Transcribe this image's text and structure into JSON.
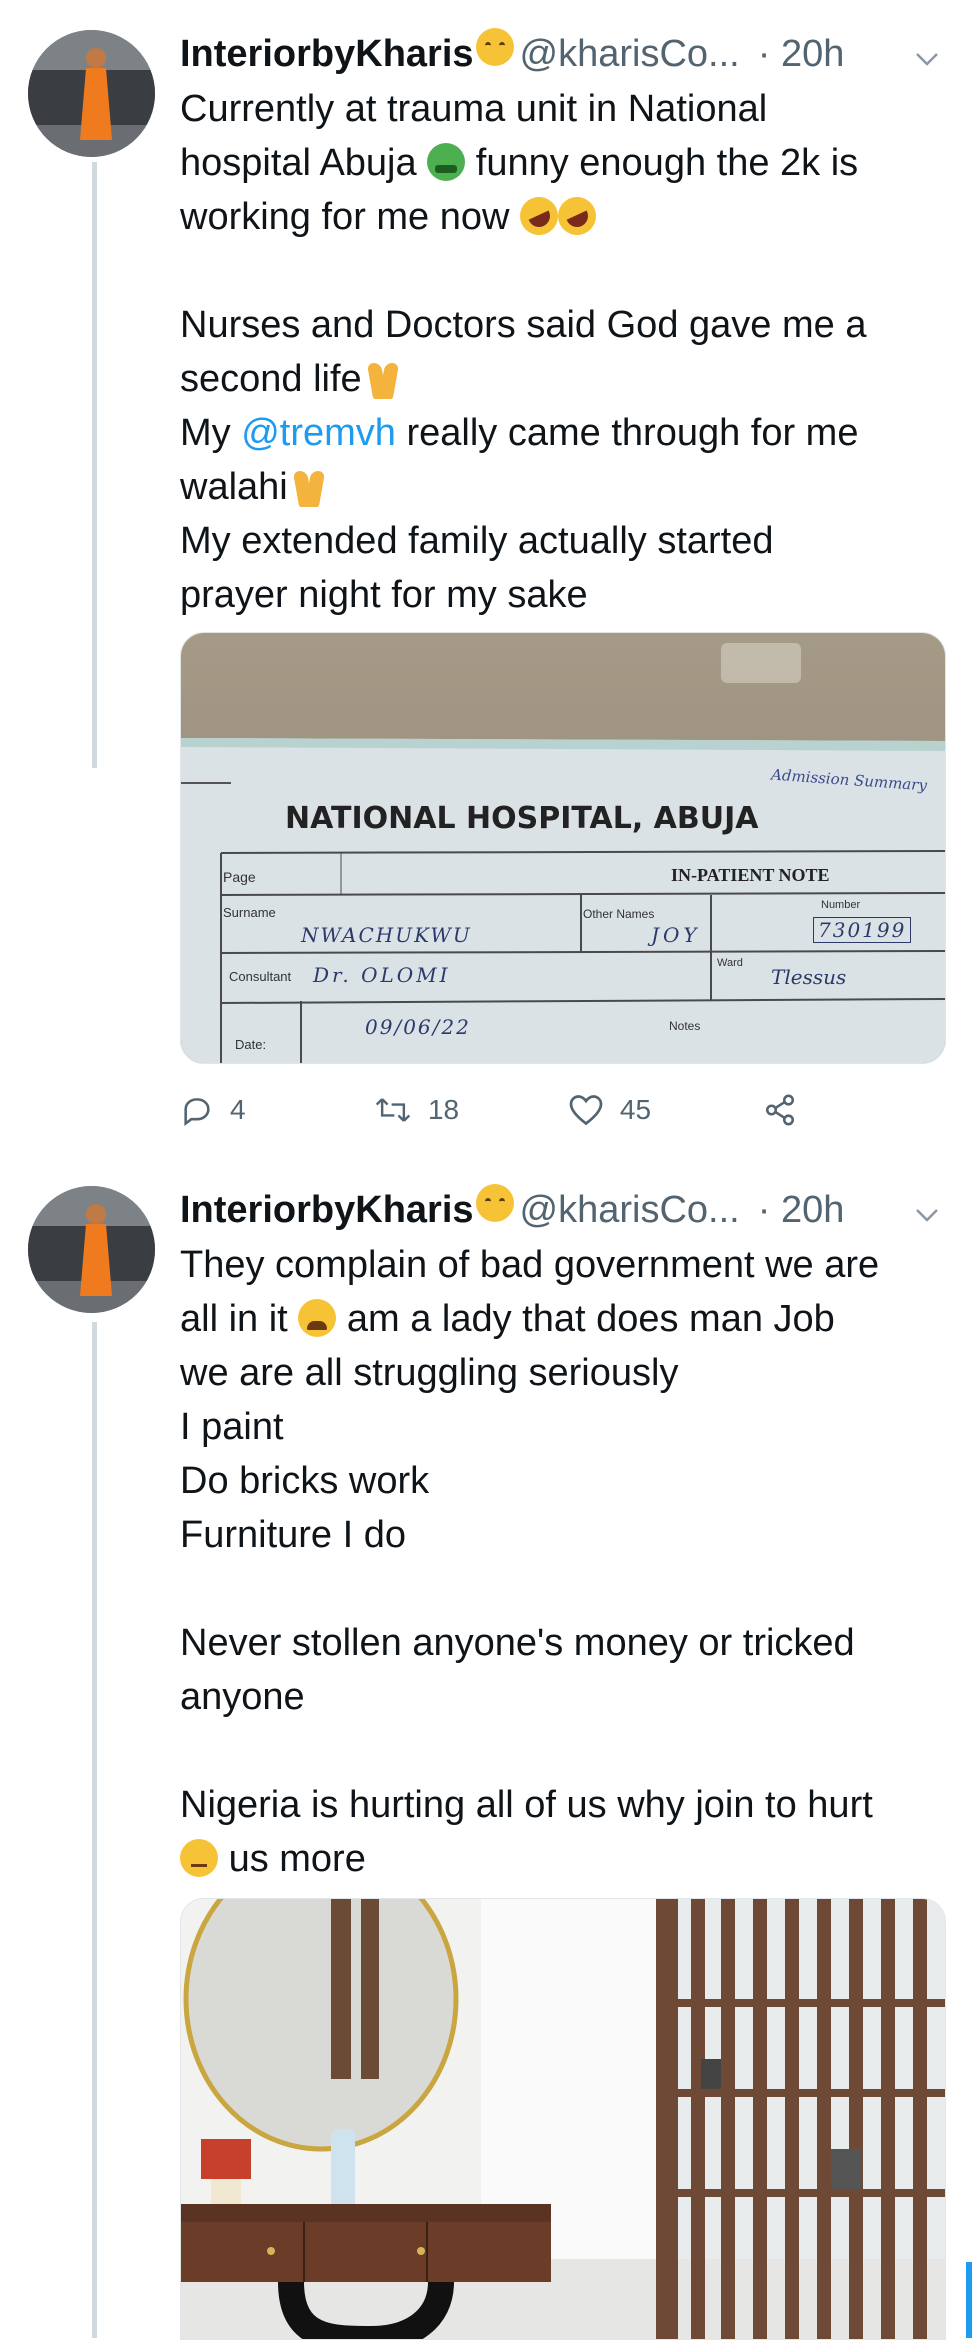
{
  "tweets": [
    {
      "name": "InteriorbyKharis",
      "handle": "@kharisCo...",
      "time": "· 20h",
      "lines": [
        "Currently at trauma unit in National",
        "hospital Abuja",
        "funny enough the 2k is",
        "working for me now",
        "Nurses and Doctors said God gave me a",
        "second life",
        "My",
        "@tremvh",
        "really came through for me",
        "walahi",
        "My extended family actually started",
        "prayer night for my sake"
      ],
      "media": {
        "title": "NATIONAL HOSPITAL, ABUJA",
        "corner_note": "Admission Summary",
        "page_label": "Page",
        "inpatient_label": "IN-PATIENT NOTE",
        "surname_label": "Surname",
        "surname_value": "NWACHUKWU",
        "other_names_label": "Other Names",
        "other_names_value": "JOY",
        "number_label": "Number",
        "number_value": "730199",
        "consultant_label": "Consultant",
        "consultant_value": "Dr. OLOMI",
        "ward_label": "Ward",
        "ward_value": "Tlessus",
        "date_label": "Date:",
        "date_value": "09/06/22",
        "notes_label": "Notes"
      },
      "actions": {
        "replies": "4",
        "retweets": "18",
        "likes": "45"
      }
    },
    {
      "name": "InteriorbyKharis",
      "handle": "@kharisCo...",
      "time": "· 20h",
      "lines": [
        "They complain of bad government we are",
        "all in it",
        "am a lady that does man Job",
        "we are all struggling seriously",
        "I paint",
        "Do bricks work",
        "Furniture I do",
        "Never stollen anyone's money or tricked",
        "anyone",
        "Nigeria is hurting all of us why join to hurt",
        "us more"
      ]
    }
  ],
  "colors": {
    "accent": "#1d9bf0",
    "muted": "#536471",
    "thread": "#cfd9de"
  },
  "icons": [
    "reply-icon",
    "retweet-icon",
    "like-icon",
    "share-icon",
    "chevron-down-icon"
  ]
}
